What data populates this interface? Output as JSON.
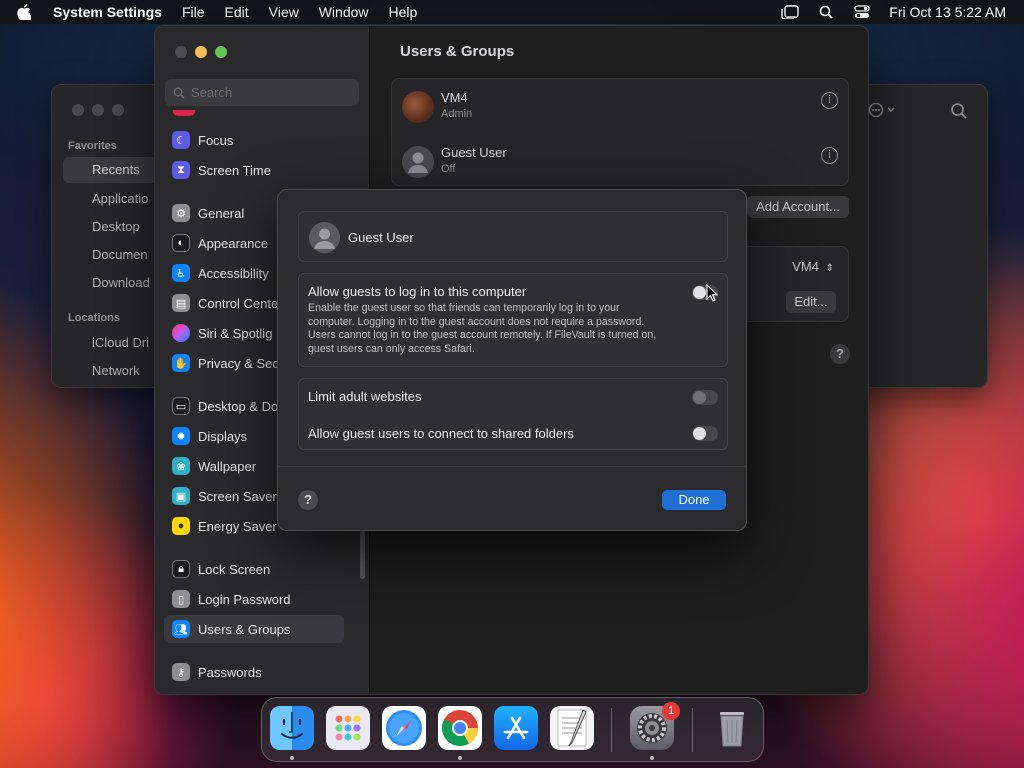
{
  "menubar": {
    "app_name": "System Settings",
    "items": [
      "File",
      "Edit",
      "View",
      "Window",
      "Help"
    ],
    "clock": "Fri Oct 13  5:22 AM"
  },
  "finder": {
    "favorites_label": "Favorites",
    "favorites": [
      "Recents",
      "Applicatio",
      "Desktop",
      "Documen",
      "Download"
    ],
    "locations_label": "Locations",
    "locations": [
      "iCloud Dri",
      "Network"
    ]
  },
  "settings": {
    "search_placeholder": "Search",
    "sidebar": [
      {
        "label": "Focus",
        "color": "#5e5ce6"
      },
      {
        "label": "Screen Time",
        "color": "#5e5ce6"
      },
      {
        "label": "General",
        "color": "#8e8e93"
      },
      {
        "label": "Appearance",
        "color": "#1c1c1e"
      },
      {
        "label": "Accessibility",
        "color": "#0a84ff"
      },
      {
        "label": "Control Cente",
        "color": "#8e8e93"
      },
      {
        "label": "Siri & Spotlig",
        "color": "#bf5af2"
      },
      {
        "label": "Privacy & Sec",
        "color": "#0a84ff"
      },
      {
        "label": "Desktop & Do",
        "color": "#1c1c1e"
      },
      {
        "label": "Displays",
        "color": "#0a84ff"
      },
      {
        "label": "Wallpaper",
        "color": "#30b0c7"
      },
      {
        "label": "Screen Saver",
        "color": "#30b0c7"
      },
      {
        "label": "Energy Saver",
        "color": "#ffd60a"
      },
      {
        "label": "Lock Screen",
        "color": "#1c1c1e"
      },
      {
        "label": "Login Password",
        "color": "#8e8e93"
      },
      {
        "label": "Users & Groups",
        "color": "#0a84ff"
      },
      {
        "label": "Passwords",
        "color": "#8e8e93"
      }
    ],
    "title": "Users & Groups",
    "users": [
      {
        "name": "VM4",
        "role": "Admin"
      },
      {
        "name": "Guest User",
        "role": "Off"
      }
    ],
    "add_account": "Add Account...",
    "vm4_select": "VM4",
    "edit": "Edit..."
  },
  "sheet": {
    "guest_name": "Guest User",
    "allow_title": "Allow guests to log in to this computer",
    "allow_desc": "Enable the guest user so that friends can temporarily log in to your computer. Logging in to the guest account does not require a password. Users cannot log in to the guest account remotely. If FileVault is turned on, guest users can only access Safari.",
    "allow_on": false,
    "limit_adult": "Limit adult websites",
    "limit_adult_on": false,
    "shared_folders": "Allow guest users to connect to shared folders",
    "shared_folders_on": false,
    "done": "Done",
    "help": "?"
  },
  "dock": {
    "apps": [
      "finder-icon",
      "launchpad-icon",
      "safari-icon",
      "chrome-icon",
      "app-store-icon",
      "textedit-icon",
      "system-settings-icon",
      "trash-icon"
    ],
    "settings_badge": "1"
  }
}
